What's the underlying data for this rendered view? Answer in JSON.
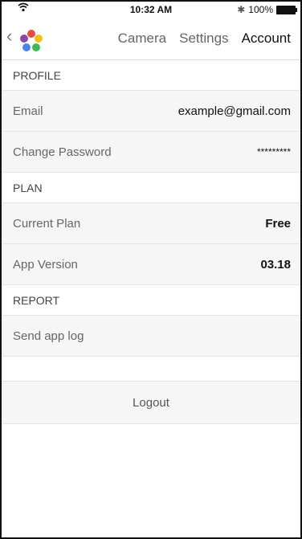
{
  "status_bar": {
    "time": "10:32 AM",
    "battery_text": "100%"
  },
  "nav": {
    "tabs": [
      {
        "label": "Camera"
      },
      {
        "label": "Settings"
      },
      {
        "label": "Account",
        "active": true
      }
    ]
  },
  "sections": {
    "profile": {
      "title": "PROFILE"
    },
    "plan": {
      "title": "PLAN"
    },
    "report": {
      "title": "REPORT"
    }
  },
  "profile": {
    "email_label": "Email",
    "email_value": "example@gmail.com",
    "password_label": "Change Password",
    "password_value": "*********"
  },
  "plan": {
    "current_label": "Current Plan",
    "current_value": "Free",
    "version_label": "App Version",
    "version_value": "03.18"
  },
  "report": {
    "send_log_label": "Send app log"
  },
  "logout_label": "Logout",
  "colors": {
    "background": "#ffffff",
    "row_bg": "#f6f6f6",
    "divider": "#e4e4e4"
  }
}
